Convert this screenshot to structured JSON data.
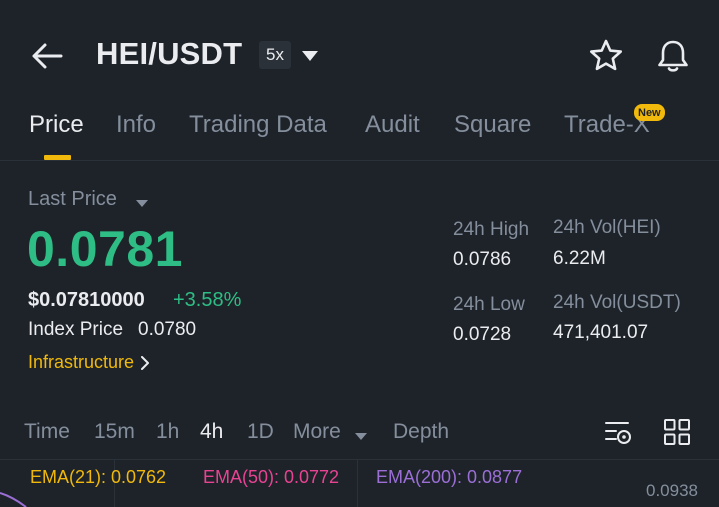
{
  "header": {
    "title": "HEI/USDT",
    "leverage": "5x",
    "icons": [
      "back-arrow-icon",
      "caret-down-icon",
      "star-icon",
      "bell-icon"
    ]
  },
  "tabs": [
    {
      "label": "Price",
      "active": true
    },
    {
      "label": "Info"
    },
    {
      "label": "Trading Data"
    },
    {
      "label": "Audit"
    },
    {
      "label": "Square"
    },
    {
      "label": "Trade-X",
      "badge": "New"
    }
  ],
  "price": {
    "last_price_label": "Last Price",
    "last_price": "0.0781",
    "usd_price": "$0.07810000",
    "change": "+3.58%",
    "index_label": "Index Price",
    "index_value": "0.0780",
    "category": "Infrastructure"
  },
  "stats": {
    "high_label": "24h High",
    "high_value": "0.0786",
    "low_label": "24h Low",
    "low_value": "0.0728",
    "vol_base_label": "24h Vol(HEI)",
    "vol_base_value": "6.22M",
    "vol_quote_label": "24h Vol(USDT)",
    "vol_quote_value": "471,401.07"
  },
  "timeframes": {
    "items": [
      "Time",
      "15m",
      "1h",
      "4h",
      "1D",
      "More"
    ],
    "active": "4h",
    "depth": "Depth"
  },
  "indicators": {
    "ema21": "EMA(21): 0.0762",
    "ema50": "EMA(50): 0.0772",
    "ema200": "EMA(200): 0.0877",
    "axis_top": "0.0938"
  },
  "colors": {
    "background": "#1e2329",
    "accent": "#f0b90b",
    "up": "#2ebd85",
    "muted": "#848e9c",
    "ema21": "#f0b90b",
    "ema50": "#e84393",
    "ema200": "#9b6fd6"
  }
}
